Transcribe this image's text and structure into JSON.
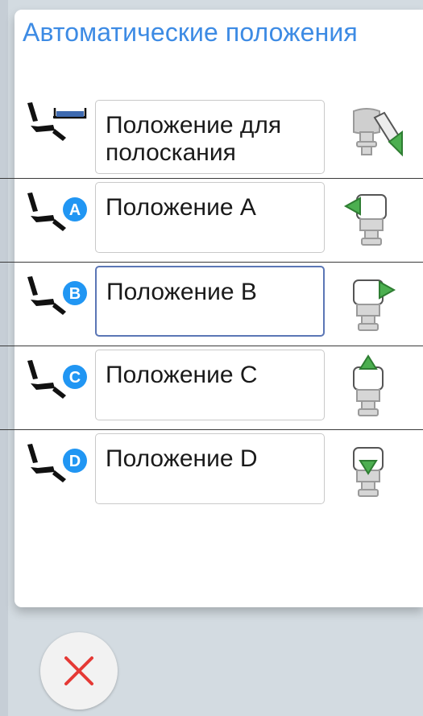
{
  "dialog": {
    "title": "Автоматические положения"
  },
  "positions": [
    {
      "label": "Положение для полоскания",
      "badge": "",
      "chair_icon": "chair-rinse-icon",
      "action_icon": "rinse-position-icon"
    },
    {
      "label": "Положение A",
      "badge": "A",
      "chair_icon": "chair-position-icon",
      "action_icon": "arrow-left-icon"
    },
    {
      "label": "Положение B",
      "badge": "B",
      "chair_icon": "chair-position-icon",
      "action_icon": "arrow-right-icon"
    },
    {
      "label": "Положение C",
      "badge": "C",
      "chair_icon": "chair-position-icon",
      "action_icon": "arrow-up-icon"
    },
    {
      "label": "Положение D",
      "badge": "D",
      "chair_icon": "chair-position-icon",
      "action_icon": "arrow-down-icon"
    }
  ],
  "colors": {
    "title": "#3d8be4",
    "badge": "#2196f3",
    "arrow": "#4caf50",
    "close": "#e53935"
  },
  "close_icon": "close-icon"
}
